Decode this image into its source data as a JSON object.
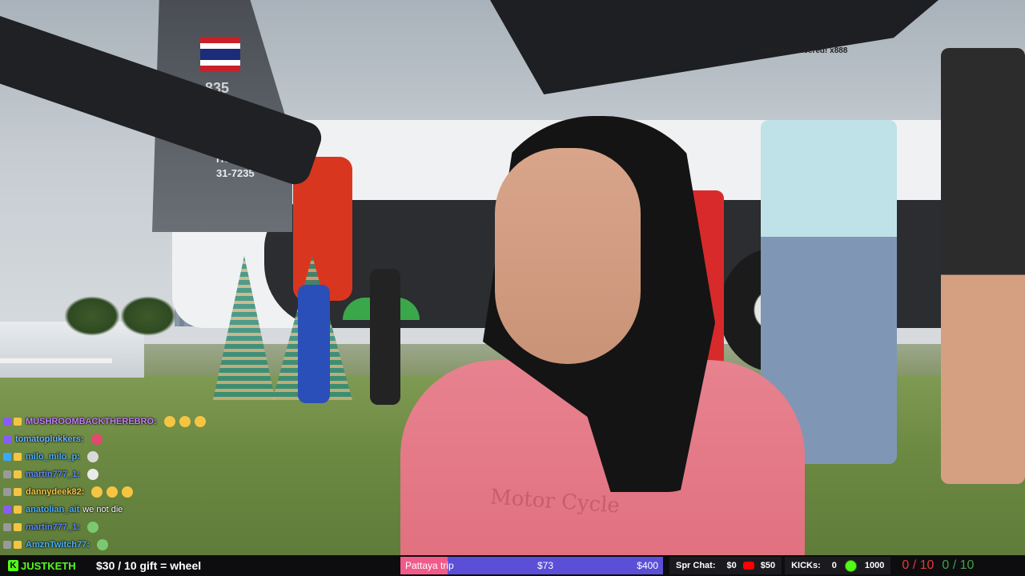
{
  "scene": {
    "tail_number": "835",
    "tail_code_1": "HU-IGB",
    "tail_code_2": "31-7235",
    "floating_note": "fathacer cheered! x888",
    "shirt_text": "Motor Cycle"
  },
  "chat": [
    {
      "user": "MUSHROOMBACKTHEREBRO:",
      "color": "#c77dff",
      "msg": "",
      "badge": "b1",
      "emote_color": "#f5c542"
    },
    {
      "user": "tomatoplukkers:",
      "color": "#6fb3ff",
      "msg": "",
      "badge": "b1",
      "emote_color": "#e04a6d"
    },
    {
      "user": "milo_milo_p:",
      "color": "#4ab0ff",
      "msg": "",
      "badge": "b2",
      "emote_color": "#d9d9d9"
    },
    {
      "user": "martin777_1:",
      "color": "#5a8cff",
      "msg": "",
      "badge": "b4",
      "emote_color": "#eaeaea"
    },
    {
      "user": "dannydeek82:",
      "color": "#f5c542",
      "msg": "",
      "badge": "b4",
      "emote_color": "#f5c542"
    },
    {
      "user": "anatolian_ait",
      "color": "#4ab0ff",
      "msg": "we not die",
      "badge": "b1",
      "emote_color": ""
    },
    {
      "user": "martin777_1:",
      "color": "#5a8cff",
      "msg": "",
      "badge": "b4",
      "emote_color": "#7bc96f"
    },
    {
      "user": "AmznTwitch77:",
      "color": "#4ab0ff",
      "msg": "",
      "badge": "b4",
      "emote_color": "#7bc96f"
    }
  ],
  "bar": {
    "brand": "JUSTKETH",
    "gift_text": "$30 / 10 gift = wheel",
    "goal": {
      "label": "Pattaya trip",
      "current": "$73",
      "max": "$400",
      "progress": 0.18
    },
    "spr_chat_label": "Spr Chat:",
    "spr_chat_value": "$0",
    "yt_value": "$50",
    "kicks_label": "KICKs:",
    "kicks_value": "0",
    "kicks_goal": "1000",
    "score_red": "0 / 10",
    "score_green": "0 / 10"
  }
}
